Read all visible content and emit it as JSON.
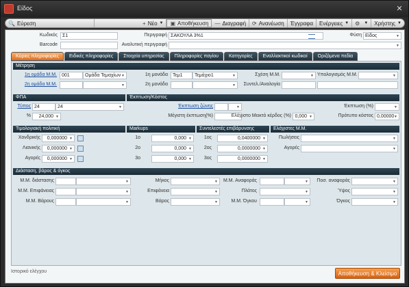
{
  "window": {
    "title": "Είδος"
  },
  "toolbar": {
    "search": "Εύρεση",
    "new": "Νέο",
    "save": "Αποθήκευση",
    "delete": "Διαγραφή",
    "refresh": "Ανανέωση",
    "documents": "Έγγραφα",
    "actions": "Ενέργειες",
    "users": "Χρήστης"
  },
  "header": {
    "code_label": "Κωδικός",
    "code_value": "Σ1",
    "desc_label": "Περιγραφή",
    "desc_value": "ΣΑΚΟΥΛΑ 3%1",
    "nature_label": "Φύση",
    "nature_value": "Είδος",
    "barcode_label": "Barcode",
    "barcode_value": "",
    "longdesc_label": "Αναλυτική περιγραφή",
    "longdesc_value": ""
  },
  "tabs": [
    "Κύριες πληροφορίες",
    "Ειδικές πληροφορίες",
    "Στοιχεία υπηρεσίας",
    "Πληροφορίες παγίου",
    "Κατηγορίες",
    "Εναλλακτικοί κωδικοί",
    "Οριζόμενα πεδία"
  ],
  "measurement": {
    "title": "Μέτρηση",
    "group1_label": "1η ομάδα Μ.Μ.",
    "group1_code": "001",
    "group1_value": "Ομάδα Τεμαχίων",
    "group2_label": "2η ομάδα Μ.Μ.",
    "unit1_label": "1η μονάδα",
    "unit1_code": "Τεμ1",
    "unit1_value": "Τεμάχιο1",
    "unit2_label": "2η μονάδα",
    "relation_label": "Σχέση Μ.Μ.",
    "calc_label": "Υπολογισμός Μ.Μ.",
    "ratio_label": "Συντελ./Αναλογία"
  },
  "vat": {
    "title": "ΦΠΑ",
    "type_label": "Τύπος",
    "type_code": "24",
    "type_value": "24",
    "pct_label": "%",
    "pct_value": "24,000"
  },
  "discount": {
    "title": "Έκπτωση/Κόστος",
    "zone_label": "Έκπτωση ζώνης",
    "max_label": "Μέγιστη έκπτωση(%)",
    "discount_label": "Έκπτωση (%)",
    "min_profit_label": "Ελάχιστο Μεικτό κέρδος (%)",
    "min_profit_value": "0,000",
    "std_cost_label": "Πρότυπο κόστος",
    "std_cost_value": "0,00000"
  },
  "pricing": {
    "title": "Τιμολογιακή πολιτική",
    "wholesale_label": "Χονδρικής",
    "wholesale_value": "0,000000",
    "retail_label": "Λιανικής",
    "retail_value": "0,000000",
    "purchase_label": "Αγορές",
    "purchase_value": "0,000000"
  },
  "markups": {
    "title": "Markups",
    "r1_label": "1ο",
    "r1_value": "0,000",
    "r2_label": "2ο",
    "r2_value": "0,000",
    "r3_label": "3ο",
    "r3_value": "0,000"
  },
  "coeffs": {
    "title": "Συντελεστές επιβάρυνσης",
    "r1_label": "1ος",
    "r1_value": "0,0400000",
    "r2_label": "2ος",
    "r2_value": "0,0000000",
    "r3_label": "3ος",
    "r3_value": "0,0000000"
  },
  "minimums": {
    "title": "Ελάχιστες Μ.Μ.",
    "sales_label": "Πωλήσεις",
    "purchases_label": "Αγορές"
  },
  "dimensions": {
    "title": "Διάσταση, βάρος & όγκος",
    "dim_label": "Μ.Μ. διάστασης",
    "surface_label": "Μ.Μ. Επιφάνειας",
    "weight_label": "Μ.Μ. Βάρους",
    "length_label": "Μήκος",
    "area_label": "Επιφάνεια",
    "weight2_label": "Βάρος",
    "ref_label": "Μ.Μ. Αναφοράς",
    "width_label": "Πλάτος",
    "volume_label": "Μ.Μ. Όγκου",
    "qty_ref_label": "Ποσ. αναφοράς",
    "height_label": "Ύψος",
    "vol_label": "Όγκος"
  },
  "footer": {
    "history": "Ιστορικό ελέγχου",
    "save_close": "Αποθήκευση & Κλείσιμο"
  },
  "colors": {
    "accent": "#e07020",
    "section": "#1b2b35"
  }
}
